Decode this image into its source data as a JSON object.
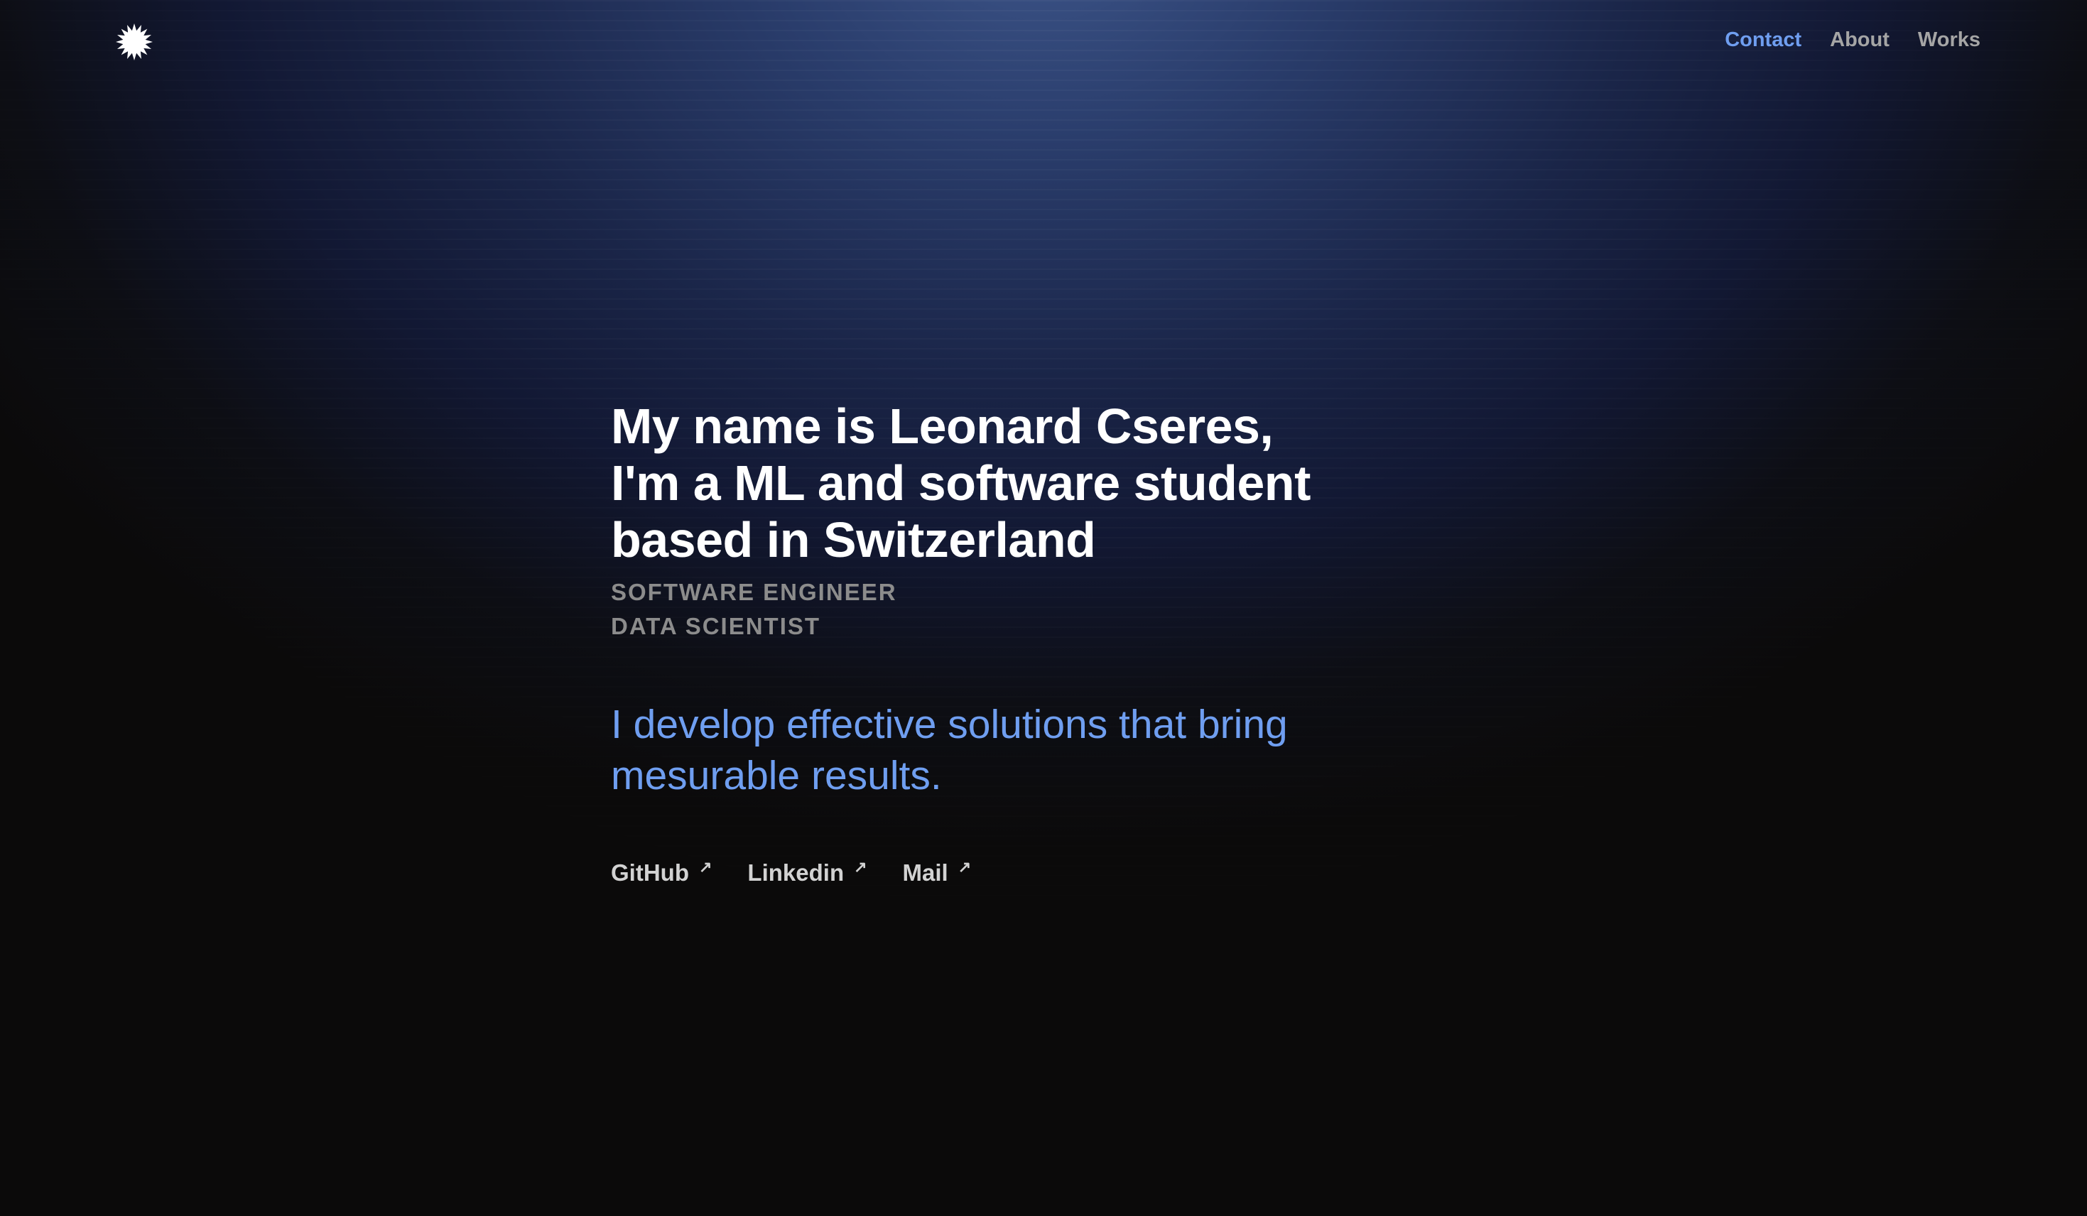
{
  "nav": {
    "logo_icon": "starburst-icon",
    "items": [
      {
        "label": "Contact",
        "active": true
      },
      {
        "label": "About",
        "active": false
      },
      {
        "label": "Works",
        "active": false
      }
    ],
    "active_color": "#6f9ef0"
  },
  "hero": {
    "headline": [
      "My name is Leonard Cseres,",
      "I'm a ML and software student",
      "based in Switzerland"
    ],
    "roles": [
      "SOFTWARE ENGINEER",
      "DATA SCIENTIST"
    ],
    "tagline": [
      "I develop effective solutions that bring",
      "mesurable results."
    ],
    "tagline_color": "#6f9ef0"
  },
  "links": {
    "items": [
      {
        "label": "GitHub",
        "icon": "external-link-arrow-icon"
      },
      {
        "label": "Linkedin",
        "icon": "external-link-arrow-icon"
      },
      {
        "label": "Mail",
        "icon": "external-link-arrow-icon"
      }
    ],
    "arrow_glyph": "↗"
  }
}
